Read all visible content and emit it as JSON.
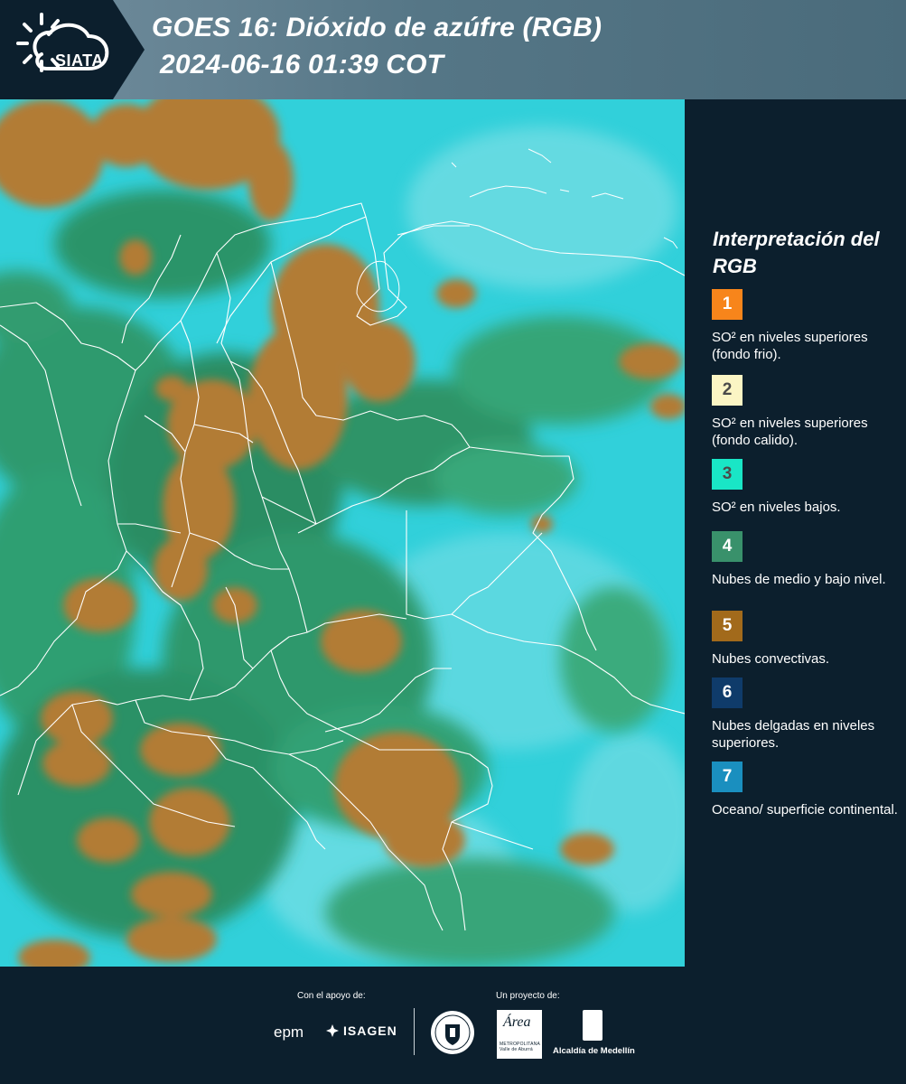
{
  "header": {
    "logo_text": "SIATA",
    "title_line1": "GOES 16: Dióxido de azúfre (RGB)",
    "title_line2": "2024-06-16 01:39 COT"
  },
  "map": {
    "image_type": "satellite-rgb-composite",
    "colors": {
      "ocean_surface": "#2ed0dc",
      "low_mid_clouds": "#2f9a6a",
      "convective_clouds": "#b07d3a",
      "borders": "#ffffff"
    }
  },
  "legend": {
    "title": "Interpretación del RGB",
    "items": [
      {
        "number": "1",
        "color": "#f7851b",
        "number_color": "#ffffff",
        "label": "SO² en niveles superiores (fondo frio)."
      },
      {
        "number": "2",
        "color": "#fbf5c4",
        "number_color": "#4a4a4a",
        "label": "SO² en niveles superiores (fondo calido)."
      },
      {
        "number": "3",
        "color": "#19e6c6",
        "number_color": "#4a4a4a",
        "label": "SO² en niveles bajos."
      },
      {
        "number": "4",
        "color": "#39916b",
        "number_color": "#ffffff",
        "label": "Nubes de medio y bajo nivel."
      },
      {
        "number": "5",
        "color": "#a26a1b",
        "number_color": "#ffffff",
        "label": "Nubes convectivas."
      },
      {
        "number": "6",
        "color": "#0f3b6a",
        "number_color": "#ffffff",
        "label": "Nubes delgadas en niveles superiores."
      },
      {
        "number": "7",
        "color": "#1a8fbf",
        "number_color": "#ffffff",
        "label": "Oceano/ superficie continental."
      }
    ]
  },
  "footer": {
    "support_label": "Con el apoyo de:",
    "project_label": "Un proyecto de:",
    "epm": "epm",
    "isagen": "ISAGEN",
    "area_name": "Área",
    "area_sub": "METROPOLITANA Valle de Aburrá",
    "alcaldia": "Alcaldía de Medellín"
  }
}
